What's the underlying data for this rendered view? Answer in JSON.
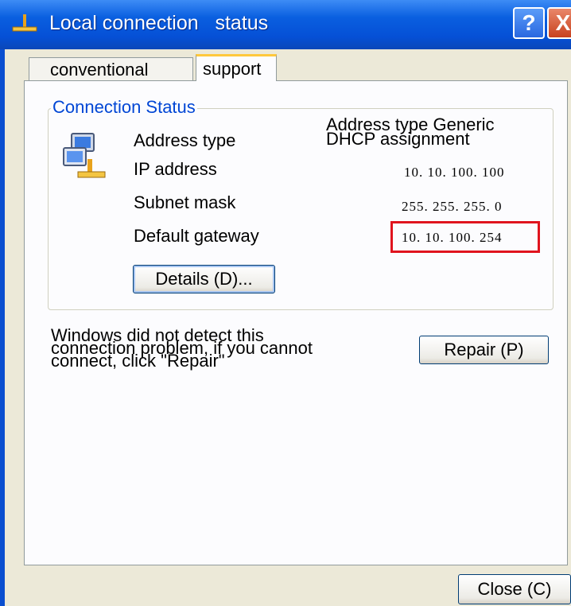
{
  "window": {
    "title": "Local connection   status",
    "help_label": "?",
    "close_glyph": "X"
  },
  "tabs": [
    {
      "label": "conventional",
      "active": false
    },
    {
      "label": "support",
      "active": true
    }
  ],
  "connection_status": {
    "group_title": "Connection Status",
    "address_type_label": "Address type",
    "address_type_value_line1": "Address type Generic",
    "address_type_value_line2": "DHCP assignment",
    "ip_label": "IP address",
    "ip_value": "10. 10. 100. 100",
    "subnet_label": "Subnet mask",
    "subnet_value": "255. 255. 255. 0",
    "gateway_label": "Default gateway",
    "gateway_value": "10. 10. 100. 254",
    "details_button": "Details (D)..."
  },
  "repair": {
    "message_line1": "Windows did not detect this",
    "message_line2": "connection problem, if you cannot",
    "message_line3": "connect, click \"Repair\"",
    "button": "Repair (P)"
  },
  "footer": {
    "close_button": "Close (C)"
  },
  "colors": {
    "titlebar": "#0550d6",
    "group_title": "#0046d5",
    "highlight_box": "#e0141e"
  }
}
